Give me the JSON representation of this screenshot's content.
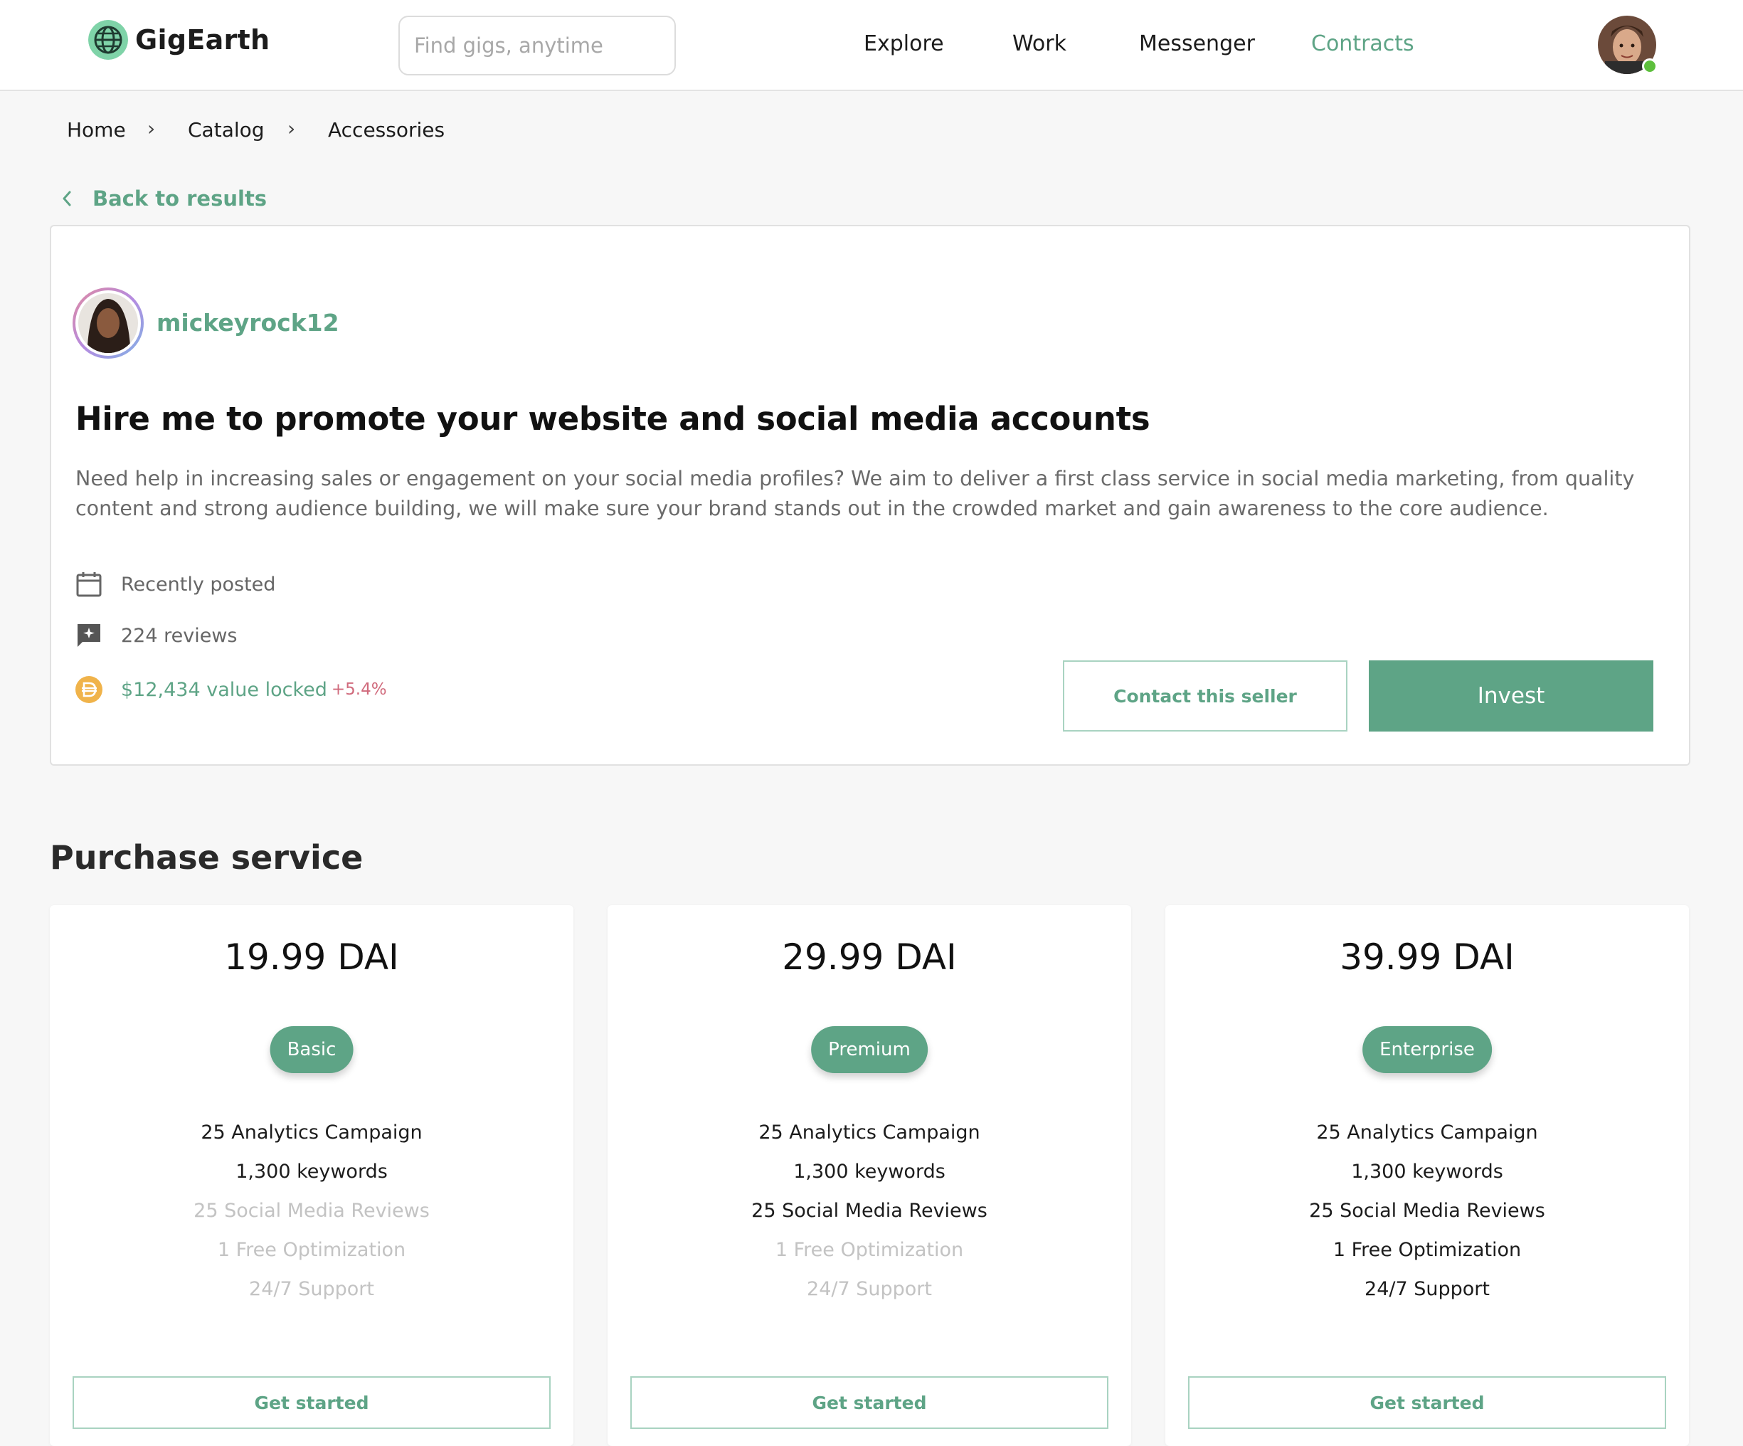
{
  "app": {
    "name": "GigEarth"
  },
  "search": {
    "placeholder": "Find gigs, anytime"
  },
  "nav": {
    "explore": "Explore",
    "work": "Work",
    "messenger": "Messenger",
    "contracts": "Contracts"
  },
  "breadcrumb": {
    "home": "Home",
    "catalog": "Catalog",
    "accessories": "Accessories",
    "separator": "›"
  },
  "back_link": "Back to results",
  "gig": {
    "seller": "mickeyrock12",
    "title": "Hire me to promote your website and social media accounts",
    "description": "Need help in increasing sales or engagement on your social media profiles? We aim to deliver a first class service in social media marketing, from quality content and strong audience building, we will make sure your brand stands out in the crowded market and gain awareness to the core audience.",
    "posted": "Recently posted",
    "reviews": "224 reviews",
    "value_locked": "$12,434 value locked",
    "value_change": "+5.4%",
    "contact_label": "Contact this seller",
    "invest_label": "Invest"
  },
  "purchase": {
    "title": "Purchase service",
    "plans": [
      {
        "price": "19.99 DAI",
        "tier": "Basic",
        "features": [
          {
            "label": "25 Analytics Campaign",
            "included": true
          },
          {
            "label": "1,300 keywords",
            "included": true
          },
          {
            "label": "25 Social Media Reviews",
            "included": false
          },
          {
            "label": "1 Free Optimization",
            "included": false
          },
          {
            "label": "24/7 Support",
            "included": false
          }
        ],
        "cta": "Get started"
      },
      {
        "price": "29.99 DAI",
        "tier": "Premium",
        "features": [
          {
            "label": "25 Analytics Campaign",
            "included": true
          },
          {
            "label": "1,300 keywords",
            "included": true
          },
          {
            "label": "25 Social Media Reviews",
            "included": true
          },
          {
            "label": "1 Free Optimization",
            "included": false
          },
          {
            "label": "24/7 Support",
            "included": false
          }
        ],
        "cta": "Get started"
      },
      {
        "price": "39.99 DAI",
        "tier": "Enterprise",
        "features": [
          {
            "label": "25 Analytics Campaign",
            "included": true
          },
          {
            "label": "1,300 keywords",
            "included": true
          },
          {
            "label": "25 Social Media Reviews",
            "included": true
          },
          {
            "label": "1 Free Optimization",
            "included": true
          },
          {
            "label": "24/7 Support",
            "included": true
          }
        ],
        "cta": "Get started"
      }
    ]
  },
  "colors": {
    "accent": "#5ea486",
    "accent_light": "#a9d3c1",
    "negative": "#d06a7c",
    "online": "#5dbf3c"
  },
  "icons": {
    "logo": "globe-logo-icon",
    "back": "chevron-left-icon",
    "posted": "calendar-icon",
    "reviews": "chat-star-icon",
    "value": "dai-coin-icon"
  }
}
